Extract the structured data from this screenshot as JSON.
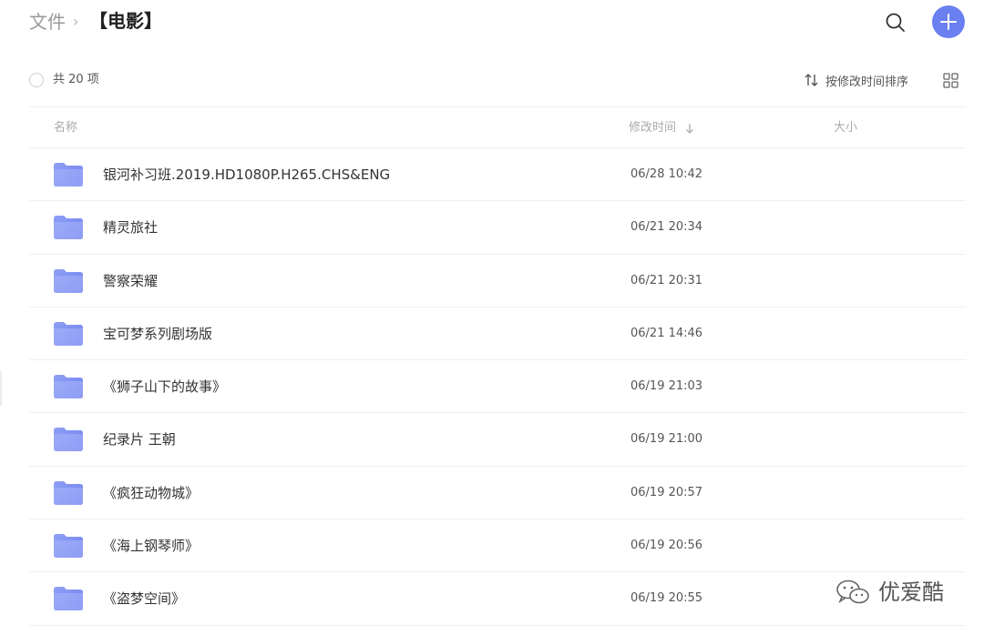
{
  "breadcrumb": {
    "root": "文件",
    "separator": "›",
    "current": "【电影】"
  },
  "header": {
    "search_icon": "search-icon",
    "add_icon": "plus-icon",
    "accent_color": "#6a7ff0"
  },
  "toolbar": {
    "count_text": "共 20 项",
    "sort_label": "按修改时间排序",
    "view_icon": "grid-view-icon"
  },
  "columns": {
    "name": "名称",
    "modified": "修改时间",
    "size": "大小"
  },
  "rows": [
    {
      "name": "银河补习班.2019.HD1080P.H265.CHS&ENG",
      "modified": "06/28 10:42"
    },
    {
      "name": "精灵旅社",
      "modified": "06/21 20:34"
    },
    {
      "name": "警察荣耀",
      "modified": "06/21 20:31"
    },
    {
      "name": "宝可梦系列剧场版",
      "modified": "06/21 14:46"
    },
    {
      "name": "《狮子山下的故事》",
      "modified": "06/19 21:03"
    },
    {
      "name": "纪录片 王朝",
      "modified": "06/19 21:00"
    },
    {
      "name": "《疯狂动物城》",
      "modified": "06/19 20:57"
    },
    {
      "name": "《海上钢琴师》",
      "modified": "06/19 20:56"
    },
    {
      "name": "《盗梦空间》",
      "modified": "06/19 20:55"
    }
  ],
  "watermark": {
    "text": "优爱酷",
    "icon": "wechat-icon"
  }
}
